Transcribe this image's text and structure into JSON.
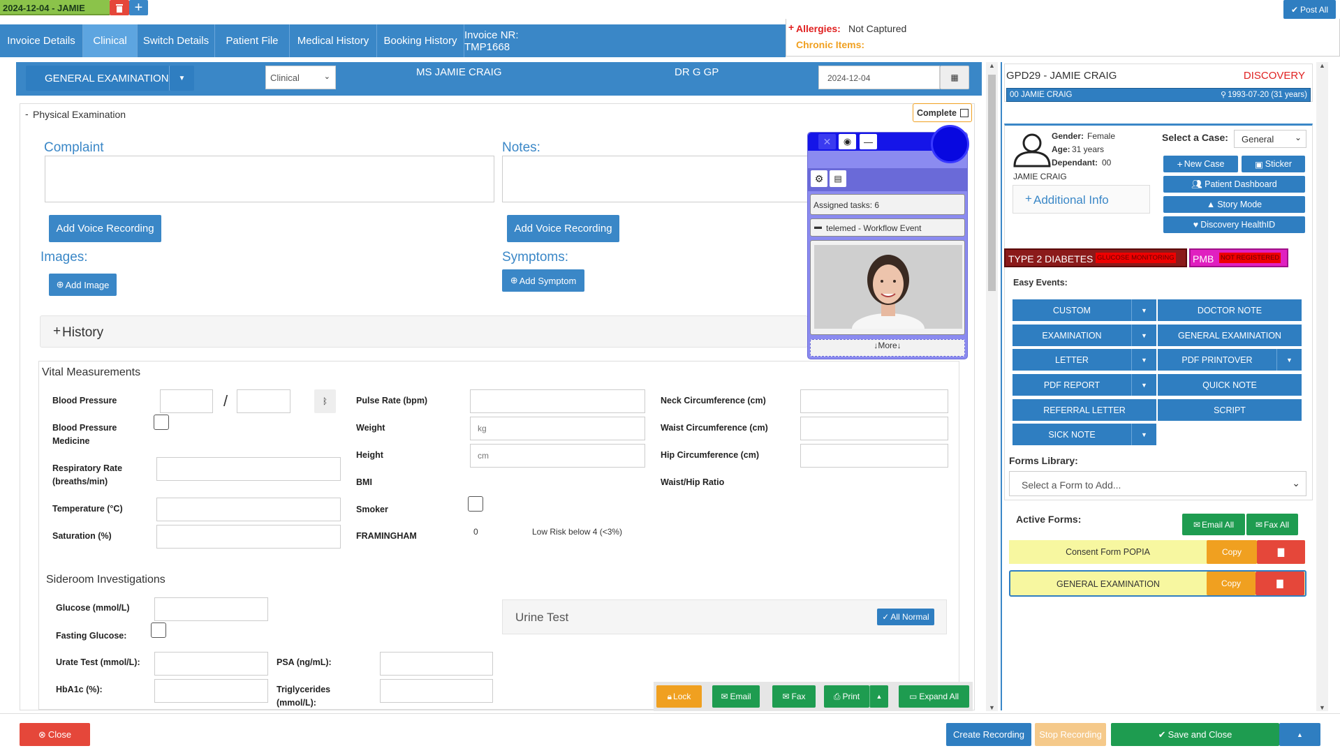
{
  "session_tab": {
    "label": "2024-12-04 - JAMIE"
  },
  "post_all": "Post All",
  "tabs": [
    "Invoice Details",
    "Clinical",
    "Switch Details",
    "Patient File",
    "Medical History",
    "Booking History",
    "Invoice NR: TMP1668"
  ],
  "alerts": {
    "allergies_label": "Allergies:",
    "allergies_value": "Not Captured",
    "chronic_label": "Chronic Items:"
  },
  "header": {
    "section_select": "GENERAL EXAMINATION",
    "mode_select": "Clinical",
    "patient": "MS JAMIE CRAIG",
    "doctor": "DR G GP",
    "date": "2024-12-04"
  },
  "physical": {
    "title": "Physical Examination",
    "complete_label": "Complete"
  },
  "complaint": {
    "label": "Complaint",
    "voice_btn": "Add Voice Recording"
  },
  "notes": {
    "label": "Notes:",
    "voice_btn": "Add Voice Recording"
  },
  "images": {
    "label": "Images:",
    "btn": "Add Image"
  },
  "symptoms": {
    "label": "Symptoms:",
    "btn": "Add Symptom"
  },
  "history": {
    "label": "History"
  },
  "vitals": {
    "title": "Vital Measurements",
    "bp": "Blood Pressure",
    "bp_sep": "/",
    "bp_med": "Blood Pressure Medicine",
    "resp": "Respiratory Rate (breaths/min)",
    "temp": "Temperature (°C)",
    "sat": "Saturation (%)",
    "pulse": "Pulse Rate (bpm)",
    "weight": "Weight",
    "weight_ph": "kg",
    "height": "Height",
    "height_ph": "cm",
    "bmi": "BMI",
    "smoker": "Smoker",
    "framingham": "FRAMINGHAM",
    "framingham_value": "0",
    "framingham_risk": "Low Risk below 4 (<3%)",
    "neck": "Neck Circumference (cm)",
    "waist": "Waist Circumference (cm)",
    "hip": "Hip Circumference (cm)",
    "whr": "Waist/Hip Ratio"
  },
  "sideroom": {
    "title": "Sideroom Investigations",
    "glucose": "Glucose (mmol/L)",
    "fasting": "Fasting Glucose:",
    "urate": "Urate Test (mmol/L):",
    "hba1c": "HbA1c (%):",
    "psa": "PSA (ng/mL):",
    "trig": "Triglycerides (mmol/L):",
    "urine": "Urine Test",
    "all_normal": "All Normal"
  },
  "action_bar": {
    "lock": "Lock",
    "email": "Email",
    "fax": "Fax",
    "print": "Print",
    "expand": "Expand All"
  },
  "widget": {
    "assigned": "Assigned tasks: 6",
    "event": "telemed - Workflow Event",
    "more": "More"
  },
  "patient_panel": {
    "code": "GPD29 - JAMIE CRAIG",
    "scheme": "DISCOVERY",
    "member": "00 JAMIE CRAIG",
    "dob": "1993-07-20 (31 years)",
    "gender_label": "Gender:",
    "gender": "Female",
    "age_label": "Age:",
    "age": "31 years",
    "dependant_label": "Dependant:",
    "dependant": "00",
    "name": "JAMIE CRAIG",
    "additional_info": "Additional Info",
    "select_case_label": "Select a Case:",
    "case_value": "General",
    "buttons": [
      "New Case",
      "Sticker",
      "Patient Dashboard",
      "Story Mode",
      "Discovery HealthID"
    ],
    "condition": "TYPE 2 DIABETES",
    "condition_tag": "GLUCOSE MONITORING",
    "pmb": "PMB",
    "pmb_tag": "NOT REGISTERED",
    "easy_events_label": "Easy Events:",
    "events": [
      "CUSTOM",
      "DOCTOR NOTE",
      "EXAMINATION",
      "GENERAL EXAMINATION",
      "LETTER",
      "PDF PRINTOVER",
      "PDF REPORT",
      "QUICK NOTE",
      "REFERRAL LETTER",
      "SCRIPT",
      "SICK NOTE"
    ],
    "forms_library_label": "Forms Library:",
    "forms_placeholder": "Select a Form to Add...",
    "active_forms_label": "Active Forms:",
    "email_all": "Email All",
    "fax_all": "Fax All",
    "forms": [
      "Consent Form POPIA",
      "GENERAL EXAMINATION"
    ],
    "copy": "Copy"
  },
  "footer": {
    "close": "Close",
    "create_recording": "Create Recording",
    "stop_recording": "Stop Recording",
    "save_close": "Save and Close"
  }
}
